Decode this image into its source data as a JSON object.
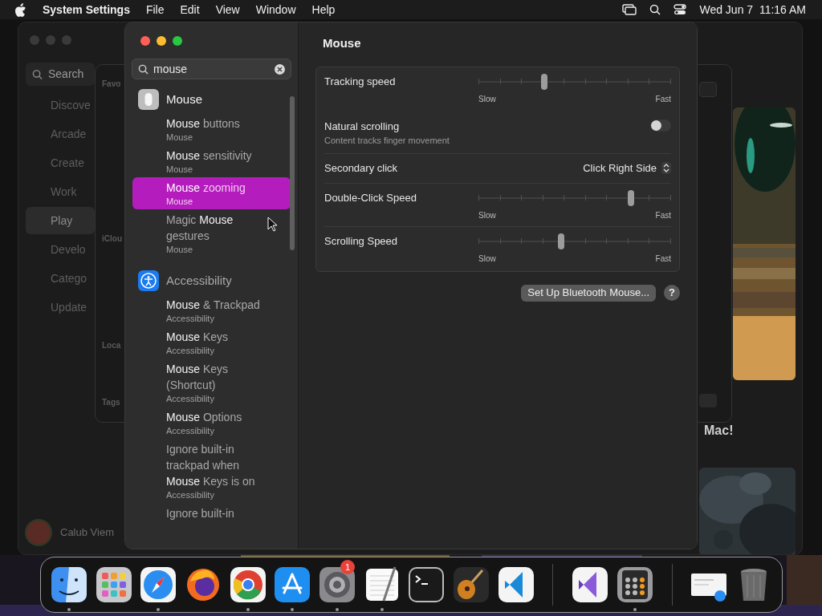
{
  "menu_bar": {
    "app": "System Settings",
    "menus": [
      "File",
      "Edit",
      "View",
      "Window",
      "Help"
    ],
    "clock": "Wed Jun 7  11:16 AM"
  },
  "app_store_window": {
    "search": {
      "placeholder": "Search"
    },
    "sidebar": [
      {
        "label": "Discove",
        "selected": false
      },
      {
        "label": "Arcade",
        "selected": false
      },
      {
        "label": "Create",
        "selected": false
      },
      {
        "label": "Work",
        "selected": false
      },
      {
        "label": "Play",
        "selected": true
      },
      {
        "label": "Develo",
        "selected": false
      },
      {
        "label": "Catego",
        "selected": false
      },
      {
        "label": "Update",
        "selected": false
      }
    ],
    "user": "Calub Viem",
    "headline": "Mac!"
  },
  "finder_window": {
    "sections": [
      "Favo",
      "iClou",
      "Loca",
      "Tags"
    ]
  },
  "settings": {
    "search": {
      "value": "mouse"
    },
    "results": [
      {
        "group": "**Mouse**",
        "kind": "mouse",
        "items": [
          {
            "title": "**Mouse** buttons",
            "subtitle": "Mouse",
            "selected": false
          },
          {
            "title": "**Mouse** sensitivity",
            "subtitle": "Mouse",
            "selected": false
          },
          {
            "title": "**Mouse** zooming",
            "subtitle": "Mouse",
            "selected": true
          },
          {
            "title": "Magic **Mouse** gestures",
            "subtitle": "Mouse",
            "selected": false
          }
        ]
      },
      {
        "group": "Accessibility",
        "kind": "accessibility",
        "items": [
          {
            "title": "**Mouse** & Trackpad",
            "subtitle": "Accessibility",
            "selected": false
          },
          {
            "title": "**Mouse** Keys",
            "subtitle": "Accessibility",
            "selected": false
          },
          {
            "title": "**Mouse** Keys (Shortcut)",
            "subtitle": "Accessibility",
            "selected": false
          },
          {
            "title": "**Mouse** Options",
            "subtitle": "Accessibility",
            "selected": false
          },
          {
            "title": "Ignore built-in trackpad when **Mouse** Keys is on",
            "subtitle": "Accessibility",
            "selected": false
          },
          {
            "title": "Ignore built-in",
            "selected": false
          }
        ]
      }
    ],
    "pane": {
      "title": "Mouse",
      "rows": [
        {
          "kind": "slider",
          "label": "Tracking speed",
          "level": 0.34,
          "min_label": "Slow",
          "max_label": "Fast"
        },
        {
          "kind": "toggle",
          "label": "Natural scrolling",
          "description": "Content tracks finger movement",
          "on": false
        },
        {
          "kind": "select",
          "label": "Secondary click",
          "value": "Click Right Side"
        },
        {
          "kind": "slider",
          "label": "Double-Click Speed",
          "level": 0.79,
          "min_label": "Slow",
          "max_label": "Fast"
        },
        {
          "kind": "slider",
          "label": "Scrolling Speed",
          "level": 0.43,
          "min_label": "Slow",
          "max_label": "Fast"
        }
      ],
      "button": "Set Up Bluetooth Mouse...",
      "help": "?"
    }
  },
  "dock": [
    {
      "kind": "finder",
      "running": true
    },
    {
      "kind": "launchpad",
      "running": false
    },
    {
      "kind": "safari",
      "running": true
    },
    {
      "kind": "firefox",
      "running": false
    },
    {
      "kind": "chrome",
      "running": true
    },
    {
      "kind": "appstore",
      "running": true
    },
    {
      "kind": "settings",
      "running": true,
      "badge": "1"
    },
    {
      "kind": "textedit",
      "running": true
    },
    {
      "kind": "terminal",
      "running": false
    },
    {
      "kind": "guitar",
      "running": false
    },
    {
      "kind": "vscode",
      "running": false
    },
    {
      "kind": "separator"
    },
    {
      "kind": "vstudio",
      "running": false
    },
    {
      "kind": "calculator",
      "running": true
    },
    {
      "kind": "separator"
    },
    {
      "kind": "document",
      "running": false
    },
    {
      "kind": "trash",
      "running": false
    }
  ]
}
